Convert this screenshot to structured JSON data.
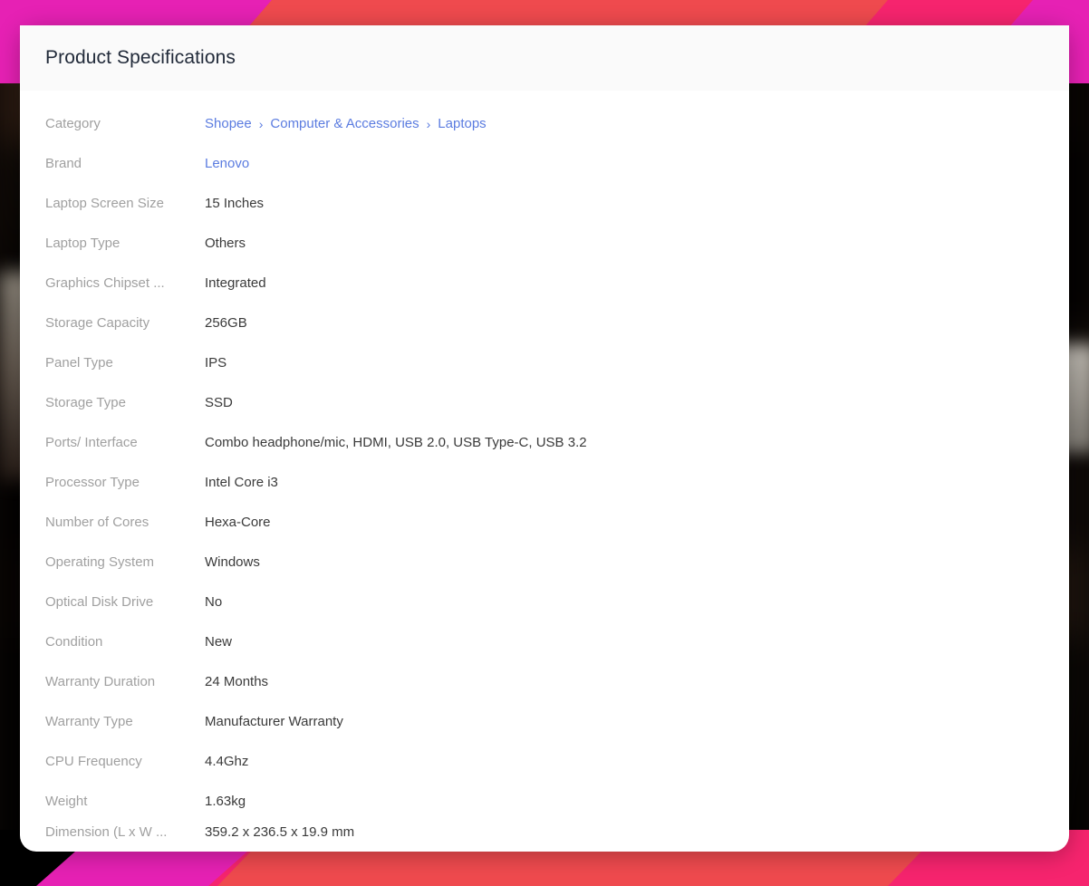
{
  "card": {
    "header_title": "Product Specifications"
  },
  "colors": {
    "link": "#5b7ce0",
    "label": "#a0a0a0",
    "value": "#3a3a3a",
    "header_bg": "#fafafa",
    "card_bg": "#ffffff",
    "ribbon_magenta": "#e621b4",
    "ribbon_pink": "#f6246e",
    "ribbon_coral": "#ef4a4e",
    "ribbon_black": "#000000"
  },
  "breadcrumb": {
    "separator": "›",
    "items": [
      {
        "label": "Shopee"
      },
      {
        "label": "Computer & Accessories"
      },
      {
        "label": "Laptops"
      }
    ]
  },
  "specs": [
    {
      "label": "Category",
      "value": "",
      "type": "breadcrumb"
    },
    {
      "label": "Brand",
      "value": "Lenovo",
      "type": "link"
    },
    {
      "label": "Laptop Screen Size",
      "value": "15 Inches",
      "type": "text"
    },
    {
      "label": "Laptop Type",
      "value": "Others",
      "type": "text"
    },
    {
      "label": "Graphics Chipset ...",
      "value": "Integrated",
      "type": "text"
    },
    {
      "label": "Storage Capacity",
      "value": "256GB",
      "type": "text"
    },
    {
      "label": "Panel Type",
      "value": "IPS",
      "type": "text"
    },
    {
      "label": "Storage Type",
      "value": "SSD",
      "type": "text"
    },
    {
      "label": "Ports/ Interface",
      "value": "Combo headphone/mic, HDMI, USB 2.0, USB Type-C, USB 3.2",
      "type": "text"
    },
    {
      "label": "Processor Type",
      "value": "Intel Core i3",
      "type": "text"
    },
    {
      "label": "Number of Cores",
      "value": "Hexa-Core",
      "type": "text"
    },
    {
      "label": "Operating System",
      "value": "Windows",
      "type": "text"
    },
    {
      "label": "Optical Disk Drive",
      "value": "No",
      "type": "text"
    },
    {
      "label": "Condition",
      "value": "New",
      "type": "text"
    },
    {
      "label": "Warranty Duration",
      "value": "24 Months",
      "type": "text"
    },
    {
      "label": "Warranty Type",
      "value": "Manufacturer Warranty",
      "type": "text"
    },
    {
      "label": "CPU Frequency",
      "value": "4.4Ghz",
      "type": "text"
    },
    {
      "label": "Weight",
      "value": "1.63kg",
      "type": "text"
    },
    {
      "label": "Dimension (L x W ...",
      "value": "359.2 x 236.5 x 19.9 mm",
      "type": "text"
    }
  ]
}
